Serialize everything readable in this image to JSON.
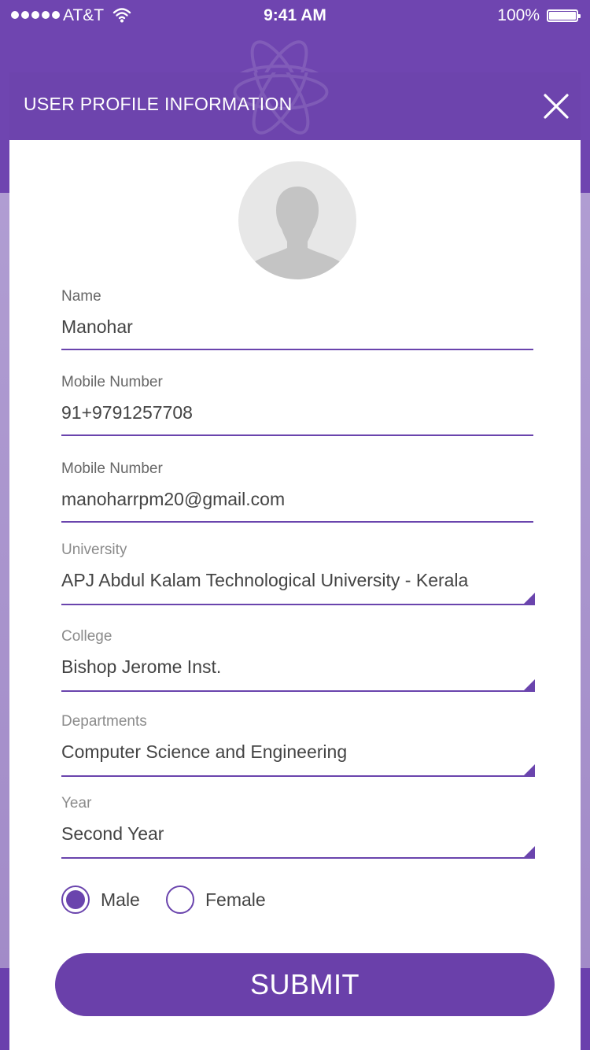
{
  "status_bar": {
    "carrier": "AT&T",
    "time": "9:41 AM",
    "battery_percent": "100%"
  },
  "modal": {
    "title": "USER PROFILE INFORMATION",
    "close_icon": "close-icon"
  },
  "avatar": {
    "icon": "user-silhouette-icon"
  },
  "fields": {
    "name": {
      "label": "Name",
      "value": "Manohar"
    },
    "mobile": {
      "label": "Mobile Number",
      "value": "91+9791257708"
    },
    "email": {
      "label": "Mobile Number",
      "value": "manoharrpm20@gmail.com"
    },
    "university": {
      "label": "University",
      "value": "APJ Abdul Kalam Technological University - Kerala"
    },
    "college": {
      "label": "College",
      "value": "Bishop Jerome Inst."
    },
    "department": {
      "label": "Departments",
      "value": "Computer Science and Engineering"
    },
    "year": {
      "label": "Year",
      "value": "Second Year"
    }
  },
  "gender": {
    "options": [
      "Male",
      "Female"
    ],
    "selected": "Male"
  },
  "submit_label": "SUBMIT",
  "colors": {
    "primary": "#6d44ad",
    "background_light": "#a893c9",
    "text": "#444444"
  }
}
